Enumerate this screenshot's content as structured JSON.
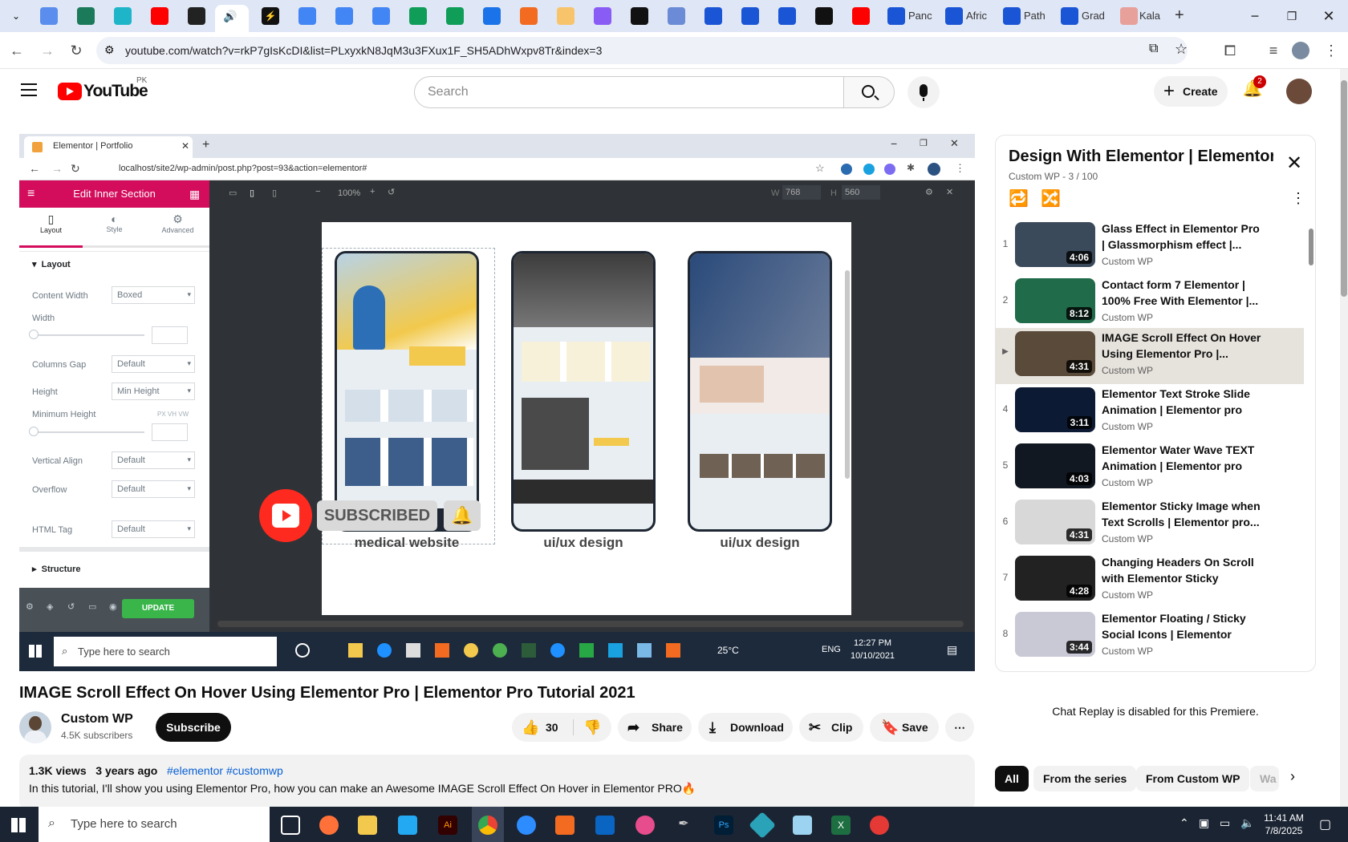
{
  "browser": {
    "tabs": [
      {
        "label": "Panc"
      },
      {
        "label": "Afric"
      },
      {
        "label": "Path"
      },
      {
        "label": "Grad"
      },
      {
        "label": "Kala"
      }
    ],
    "url": "youtube.com/watch?v=rkP7gIsKcDI&list=PLxyxkN8JqM3u3FXux1F_SH5ADhWxpv8Tr&index=3"
  },
  "youtube": {
    "logo_text": "YouTube",
    "region": "PK",
    "search_placeholder": "Search",
    "create_label": "Create",
    "notification_count": "2"
  },
  "video": {
    "inner": {
      "tab_title": "Elementor | Portfolio",
      "url": "localhost/site2/wp-admin/post.php?post=93&action=elementor#",
      "panel_title": "Edit Inner Section",
      "tabs": [
        "Layout",
        "Style",
        "Advanced"
      ],
      "section_label": "Layout",
      "structure_label": "Structure",
      "fields": [
        {
          "label": "Content Width",
          "value": "Boxed"
        },
        {
          "label": "Width",
          "value": ""
        },
        {
          "label": "Columns Gap",
          "value": "Default"
        },
        {
          "label": "Height",
          "value": "Min Height"
        },
        {
          "label": "Minimum Height",
          "value": ""
        },
        {
          "label": "Vertical Align",
          "value": "Default"
        },
        {
          "label": "Overflow",
          "value": "Default"
        },
        {
          "label": "HTML Tag",
          "value": "Default"
        }
      ],
      "units": "PX  VH  VW",
      "update_label": "UPDATE",
      "zoom": "100%",
      "w_label": "W",
      "w_value": "768",
      "h_label": "H",
      "h_value": "560",
      "captions": [
        "medical website",
        "ui/ux design",
        "ui/ux design"
      ],
      "subscribed_text": "SUBSCRIBED",
      "taskbar_search": "Type here to search",
      "weather": "25°C",
      "lang": "ENG",
      "time": "12:27 PM",
      "date": "10/10/2021"
    },
    "title": "IMAGE Scroll Effect On Hover Using Elementor Pro | Elementor Pro Tutorial 2021",
    "channel": "Custom WP",
    "subscribers": "4.5K subscribers",
    "subscribe_label": "Subscribe",
    "likes": "30",
    "share_label": "Share",
    "download_label": "Download",
    "clip_label": "Clip",
    "save_label": "Save",
    "views": "1.3K views",
    "age": "3 years ago",
    "hashtags": "#elementor #customwp",
    "description": "In this tutorial, I'll show you using Elementor Pro, how you can make an Awesome IMAGE Scroll Effect On Hover in Elementor PRO🔥"
  },
  "playlist": {
    "title": "Design With Elementor | Elementor ...",
    "subtitle_channel": "Custom WP",
    "subtitle_position": "3 / 100",
    "items": [
      {
        "index": "1",
        "title": "Glass Effect in Elementor Pro | Glassmorphism effect |...",
        "channel": "Custom WP",
        "duration": "4:06",
        "thumb_color": "#3a4a5a"
      },
      {
        "index": "2",
        "title": "Contact form 7 Elementor | 100% Free With Elementor |...",
        "channel": "Custom WP",
        "duration": "8:12",
        "thumb_color": "#1f6b4a"
      },
      {
        "index": "▶",
        "title": "IMAGE Scroll Effect On Hover Using Elementor Pro |...",
        "channel": "Custom WP",
        "duration": "4:31",
        "thumb_color": "#5a4a3a"
      },
      {
        "index": "4",
        "title": "Elementor Text Stroke Slide Animation | Elementor pro Tip...",
        "channel": "Custom WP",
        "duration": "3:11",
        "thumb_color": "#0d1a33"
      },
      {
        "index": "5",
        "title": "Elementor Water Wave TEXT Animation | Elementor pro Tip...",
        "channel": "Custom WP",
        "duration": "4:03",
        "thumb_color": "#111822"
      },
      {
        "index": "6",
        "title": "Elementor Sticky Image when Text Scrolls | Elementor pro...",
        "channel": "Custom WP",
        "duration": "4:31",
        "thumb_color": "#d8d8d8"
      },
      {
        "index": "7",
        "title": "Changing Headers On Scroll with Elementor Sticky Header...",
        "channel": "Custom WP",
        "duration": "4:28",
        "thumb_color": "#222222"
      },
      {
        "index": "8",
        "title": "Elementor Floating / Sticky Social Icons | Elementor Pro...",
        "channel": "Custom WP",
        "duration": "3:44",
        "thumb_color": "#c9c9d6"
      }
    ]
  },
  "chat_replay": "Chat Replay is disabled for this Premiere.",
  "chips": [
    "All",
    "From the series",
    "From Custom WP",
    "Wa"
  ],
  "taskbar": {
    "search": "Type here to search",
    "time": "11:41 AM",
    "date": "7/8/2025"
  }
}
